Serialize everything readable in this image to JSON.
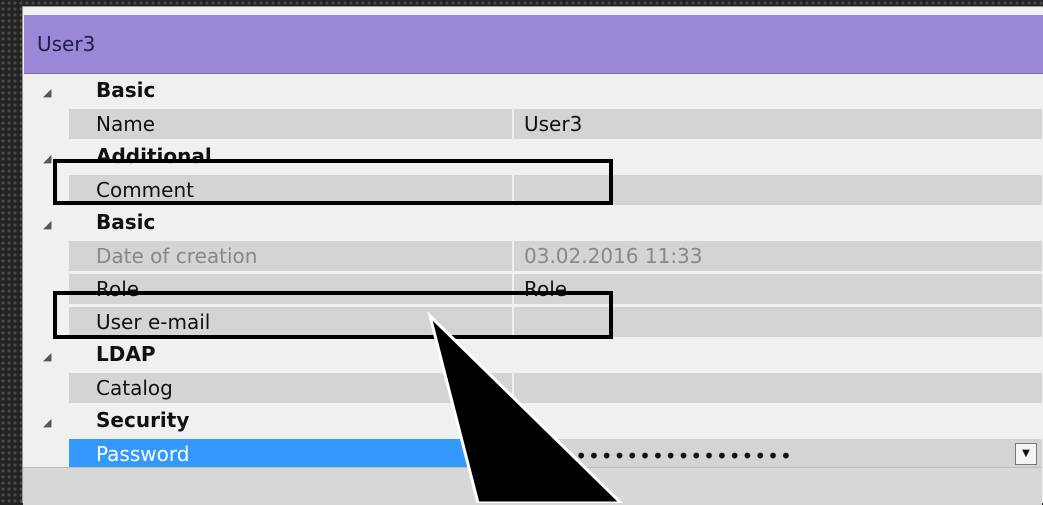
{
  "window": {
    "title": "User3"
  },
  "grid": {
    "categories": {
      "basic1": "Basic",
      "additional": "Additional",
      "basic2": "Basic",
      "ldap": "LDAP",
      "security": "Security"
    },
    "properties": {
      "name": {
        "label": "Name",
        "value": "User3"
      },
      "comment": {
        "label": "Comment",
        "value": ""
      },
      "date_of_creation": {
        "label": "Date of creation",
        "value": "03.02.2016 11:33"
      },
      "role": {
        "label": "Role",
        "value": "Role"
      },
      "user_email": {
        "label": "User e-mail",
        "value": ""
      },
      "catalog": {
        "label": "Catalog",
        "value": ""
      },
      "password": {
        "label": "Password",
        "value": "•••••••••••••••••••••"
      }
    }
  },
  "icons": {
    "expand": "triangle-down-right-icon",
    "dropdown": "chevron-down-icon",
    "pointer": "arrow-pointer-icon"
  },
  "colors": {
    "title_bar": "#9a88d6",
    "selection": "#3399ff",
    "row_bg": "#d4d4d4",
    "highlight_border": "#000000"
  }
}
